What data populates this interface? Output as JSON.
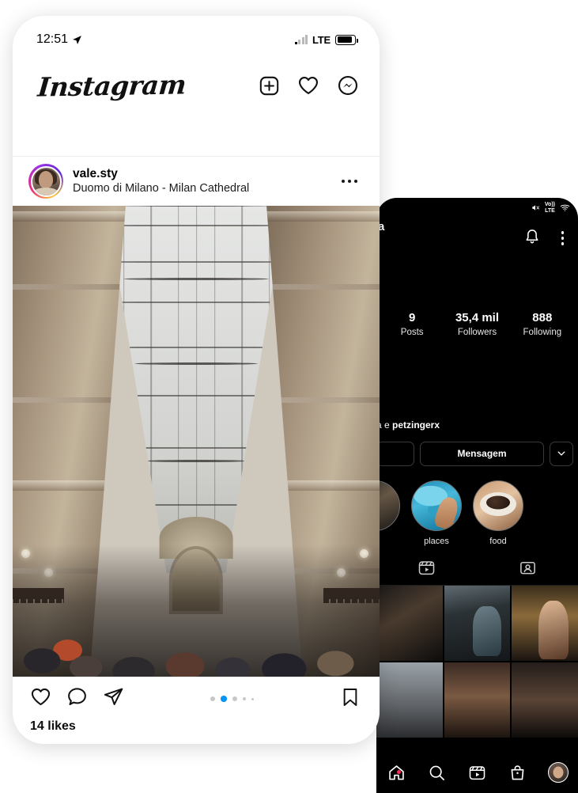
{
  "feed_phone": {
    "status_bar": {
      "time": "12:51",
      "location_icon": "location-arrow-icon",
      "network_label": "LTE",
      "signal_icon": "signal-bars-icon",
      "battery_icon": "battery-icon"
    },
    "top_bar": {
      "wordmark": "Instagram",
      "actions": [
        {
          "name": "new-post-icon",
          "label": "New post"
        },
        {
          "name": "activity-heart-icon",
          "label": "Activity"
        },
        {
          "name": "messenger-icon",
          "label": "Messenger"
        }
      ]
    },
    "post": {
      "username": "vale.sty",
      "location": "Duomo di Milano - Milan Cathedral",
      "more_options_icon": "more-options-icon",
      "avatar_icon": "user-avatar",
      "photo_alt": "Galleria Vittorio Emanuele II glass vaulted arcade with crowds",
      "actions": {
        "like_icon": "heart-icon",
        "comment_icon": "comment-icon",
        "share_icon": "share-paper-plane-icon",
        "save_icon": "bookmark-icon"
      },
      "carousel": {
        "total": 5,
        "active_index": 2
      },
      "likes": "14 likes"
    }
  },
  "profile_phone": {
    "status_bar": {
      "mute_icon": "mute-icon",
      "volte_line1": "Vo))",
      "volte_line2": "LTE",
      "wifi_icon": "wifi-icon"
    },
    "top_bar": {
      "username_partial": "a",
      "notifications_icon": "bell-icon",
      "menu_icon": "kebab-menu-icon"
    },
    "stats": [
      {
        "value": "9",
        "label": "Posts"
      },
      {
        "value": "35,4 mil",
        "label": "Followers"
      },
      {
        "value": "888",
        "label": "Following"
      }
    ],
    "bio": {
      "prefix": "a e ",
      "mention": "petzingerx"
    },
    "buttons": {
      "follow_label": "",
      "message_label": "Mensagem",
      "chevron_icon": "chevron-down-icon"
    },
    "highlights": [
      {
        "label": "",
        "icon": "highlight-car"
      },
      {
        "label": "places",
        "icon": "highlight-pool"
      },
      {
        "label": "food",
        "icon": "highlight-dessert"
      }
    ],
    "tabs": [
      {
        "name": "tab-reels",
        "icon": "reels-icon"
      },
      {
        "name": "tab-tagged",
        "icon": "tagged-person-icon"
      }
    ],
    "grid": [
      {
        "name": "grid-photo-crowd",
        "style": "g-darkcrowd"
      },
      {
        "name": "grid-photo-car-selfie",
        "style": "g-car"
      },
      {
        "name": "grid-photo-night-street",
        "style": "g-night"
      },
      {
        "name": "grid-photo-road",
        "style": "g-row2a"
      },
      {
        "name": "grid-photo-portrait",
        "style": "g-row2b"
      },
      {
        "name": "grid-photo-dark-scene",
        "style": "g-row2c"
      }
    ],
    "bottom_nav": [
      {
        "name": "nav-home",
        "icon": "home-icon",
        "badge": true
      },
      {
        "name": "nav-search",
        "icon": "search-icon",
        "badge": false
      },
      {
        "name": "nav-reels",
        "icon": "reels-icon",
        "badge": false
      },
      {
        "name": "nav-shop",
        "icon": "shop-bag-icon",
        "badge": false
      },
      {
        "name": "nav-profile",
        "icon": "profile-avatar-icon",
        "badge": false
      }
    ]
  },
  "colors": {
    "accent_blue": "#0095f6",
    "badge_red": "#ff2d55",
    "dark_bg": "#000000",
    "light_bg": "#ffffff"
  }
}
